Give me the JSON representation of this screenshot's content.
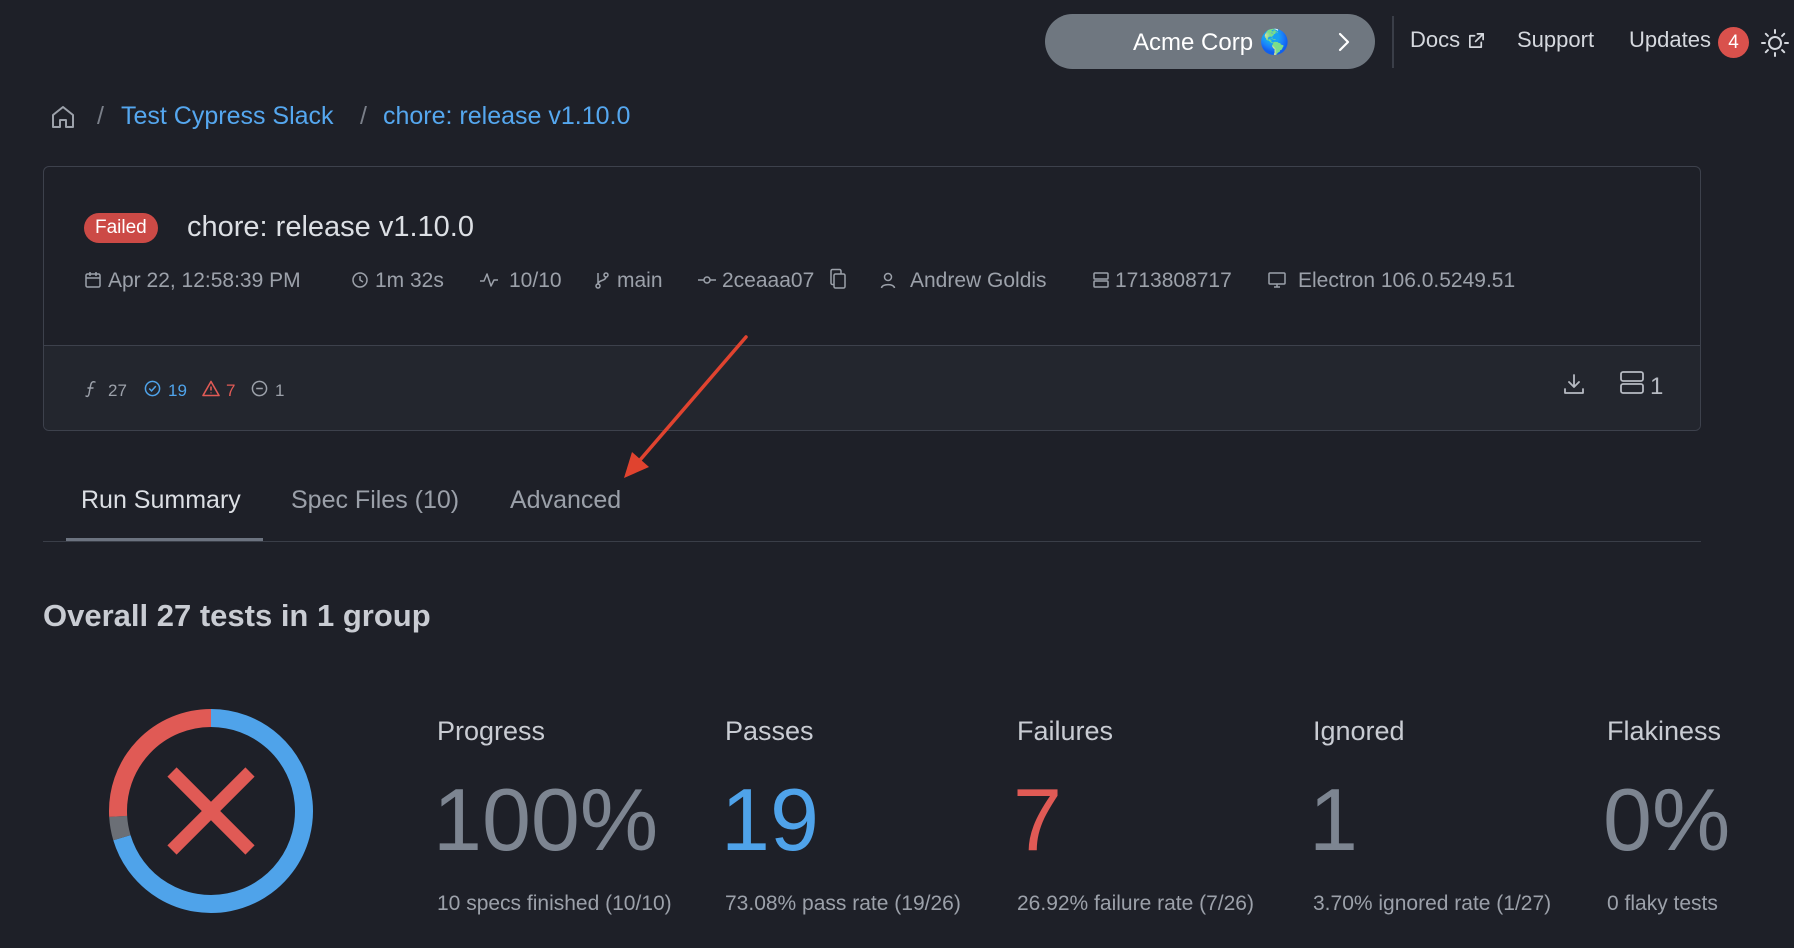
{
  "topbar": {
    "org_label": "Acme Corp 🌎",
    "docs_label": "Docs",
    "support_label": "Support",
    "updates_label": "Updates",
    "updates_count": "4"
  },
  "breadcrumb": {
    "project": "Test Cypress Slack",
    "run": "chore: release v1.10.0"
  },
  "run": {
    "status": "Failed",
    "title": "chore: release v1.10.0",
    "date": "Apr 22, 12:58:39 PM",
    "duration": "1m 32s",
    "specs": "10/10",
    "branch": "main",
    "commit": "2ceaaa07",
    "author": "Andrew Goldis",
    "ci_build": "1713808717",
    "browser": "Electron 106.0.5249.51",
    "stats": {
      "total": "27",
      "passed": "19",
      "failed": "7",
      "skipped": "1"
    },
    "groups_count": "1"
  },
  "tabs": [
    {
      "label": "Run Summary"
    },
    {
      "label": "Spec Files (10)"
    },
    {
      "label": "Advanced"
    }
  ],
  "summary": {
    "title": "Overall 27 tests in 1 group",
    "donut": {
      "passed": 19,
      "failed": 7,
      "skipped": 1
    },
    "metrics": [
      {
        "label": "Progress",
        "value": "100%",
        "sub": "10 specs finished (10/10)"
      },
      {
        "label": "Passes",
        "value": "19",
        "sub": "73.08% pass rate (19/26)"
      },
      {
        "label": "Failures",
        "value": "7",
        "sub": "26.92% failure rate (7/26)"
      },
      {
        "label": "Ignored",
        "value": "1",
        "sub": "3.70% ignored rate (1/27)"
      },
      {
        "label": "Flakiness",
        "value": "0%",
        "sub": "0 flaky tests"
      }
    ]
  },
  "colors": {
    "background": "#1e2028",
    "link": "#55a7ef",
    "passed": "#4fa3ea",
    "failed": "#e05a55",
    "skipped": "#6b6f76",
    "annotation_arrow": "#e0432f"
  },
  "icons": [
    "home-icon",
    "calendar-icon",
    "clock-icon",
    "activity-icon",
    "git-branch-icon",
    "git-commit-icon",
    "copy-icon",
    "user-icon",
    "server-icon",
    "monitor-icon",
    "download-icon",
    "external-link-icon",
    "sun-icon",
    "chevron-right-icon",
    "x-icon"
  ]
}
